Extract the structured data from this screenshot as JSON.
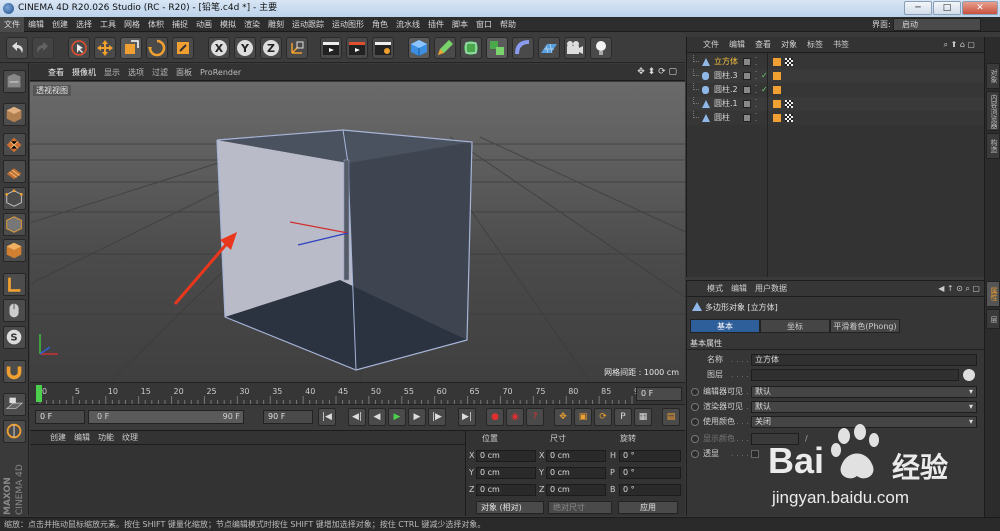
{
  "window": {
    "title": "CINEMA 4D R20.026 Studio (RC - R20) - [铅笔.c4d *] - 主要",
    "minimize": "─",
    "maximize": "□",
    "close": "✕"
  },
  "menubar": {
    "items": [
      "文件",
      "编辑",
      "创建",
      "选择",
      "工具",
      "网格",
      "体积",
      "捕捉",
      "动画",
      "模拟",
      "渲染",
      "雕刻",
      "运动跟踪",
      "运动图形",
      "角色",
      "流水线",
      "插件",
      "脚本",
      "窗口",
      "帮助"
    ],
    "layout_label": "界面:",
    "layout_value": "启动"
  },
  "toolbar": {
    "axis_labels": [
      "X",
      "Y",
      "Z"
    ]
  },
  "viewport": {
    "menu": [
      "查看",
      "摄像机",
      "显示",
      "选项",
      "过滤",
      "面板",
      "ProRender"
    ],
    "label": "透视视图",
    "grid_info": "网格间距 : 1000 cm"
  },
  "timeline": {
    "ticks": [
      "0",
      "5",
      "10",
      "15",
      "20",
      "25",
      "30",
      "35",
      "40",
      "45",
      "50",
      "55",
      "60",
      "65",
      "70",
      "75",
      "80",
      "85",
      "90"
    ],
    "end_field": "0 F",
    "progress": 0.0
  },
  "animation": {
    "start": "0 F",
    "range_start": "0 F",
    "range_end": "90 F",
    "end": "90 F",
    "play_glyph": "▶",
    "transport": {
      "first": "|◀",
      "prev_key": "◀|",
      "prev": "◀",
      "next": "▶",
      "next_key": "|▶",
      "last": "▶|"
    }
  },
  "material_manager": {
    "menu": [
      "创建",
      "编辑",
      "功能",
      "纹理"
    ]
  },
  "coordinates": {
    "headers": [
      "位置",
      "尺寸",
      "旋转"
    ],
    "rows": [
      {
        "axis": "X",
        "pos": "0 cm",
        "size_axis": "X",
        "size": "0 cm",
        "rot_axis": "H",
        "rot": "0 °"
      },
      {
        "axis": "Y",
        "pos": "0 cm",
        "size_axis": "Y",
        "size": "0 cm",
        "rot_axis": "P",
        "rot": "0 °"
      },
      {
        "axis": "Z",
        "pos": "0 cm",
        "size_axis": "Z",
        "size": "0 cm",
        "rot_axis": "B",
        "rot": "0 °"
      }
    ],
    "mode": "对象 (相对)",
    "size_mode": "绝对尺寸",
    "apply": "应用"
  },
  "object_manager": {
    "menu": [
      "文件",
      "编辑",
      "查看",
      "对象",
      "标签",
      "书签"
    ],
    "objects": [
      {
        "name": "立方体",
        "type": "polygon",
        "selected": true,
        "check": false
      },
      {
        "name": "圆柱.3",
        "type": "cylinder",
        "selected": false,
        "check": true
      },
      {
        "name": "圆柱.2",
        "type": "cylinder",
        "selected": false,
        "check": true
      },
      {
        "name": "圆柱.1",
        "type": "polygon",
        "selected": false,
        "check": false
      },
      {
        "name": "圆柱",
        "type": "polygon",
        "selected": false,
        "check": false
      }
    ]
  },
  "attributes": {
    "menu": [
      "模式",
      "编辑",
      "用户数据"
    ],
    "object_title": "多边形对象 [立方体]",
    "tabs": [
      "基本",
      "坐标",
      "平滑着色(Phong)"
    ],
    "section": "基本属性",
    "fields": [
      {
        "label": "名称",
        "value": "立方体"
      },
      {
        "label": "图层",
        "value": ""
      },
      {
        "label": "编辑器可见",
        "value": "默认"
      },
      {
        "label": "渲染器可见",
        "value": "默认"
      },
      {
        "label": "使用颜色",
        "value": "关闭"
      },
      {
        "label": "显示颜色",
        "value": ""
      },
      {
        "label": "透显",
        "value": ""
      }
    ]
  },
  "right_tabs": [
    "对象",
    "内容浏览器",
    "构造",
    "属性",
    "层"
  ],
  "brand": {
    "maxon": "MAXON",
    "cinema": "CINEMA 4D"
  },
  "status": "缩放：点击并拖动鼠标缩放元素。按住 SHIFT 键量化缩放；节点编辑模式时按住 SHIFT 键增加选择对象；按住 CTRL 键减少选择对象。",
  "watermark": {
    "brand": "Bai",
    "brand2": "经验",
    "url": "jingyan.baidu.com"
  },
  "colors": {
    "accent": "#f0a030",
    "selected_obj": "#f5c040",
    "panel": "#333333",
    "highlight_tab": "#2f5f9a"
  }
}
